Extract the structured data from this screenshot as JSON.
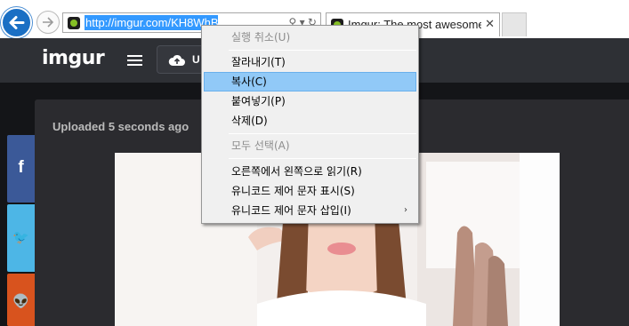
{
  "browser": {
    "url": "http://imgur.com/KH8WhBl",
    "tab_title": "Imgur: The most awesome images on the Internet",
    "tab_close": "✕",
    "address_tools": "⚲ ▾ ↻"
  },
  "imgur": {
    "logo": "imgur",
    "upload_label": "U",
    "uploaded_text": "Uploaded 5 seconds ago"
  },
  "share": {
    "facebook": "f",
    "twitter": "🐦",
    "reddit": "👽"
  },
  "context_menu": {
    "items": [
      {
        "label": "실행 취소(U)"
      },
      {
        "label": "잘라내기(T)"
      },
      {
        "label": "복사(C)"
      },
      {
        "label": "붙여넣기(P)"
      },
      {
        "label": "삭제(D)"
      },
      {
        "label": "모두 선택(A)"
      },
      {
        "label": "오른쪽에서 왼쪽으로 읽기(R)"
      },
      {
        "label": "유니코드 제어 문자 표시(S)"
      },
      {
        "label": "유니코드 제어 문자 삽입(I)"
      }
    ],
    "submenu_arrow": "›"
  },
  "colors": {
    "imgur_accent": "#85bf25",
    "selection": "#3399ff",
    "menu_highlight": "#91c9f7",
    "facebook": "#3b5998",
    "twitter": "#4db6e6",
    "reddit": "#d8531e"
  }
}
